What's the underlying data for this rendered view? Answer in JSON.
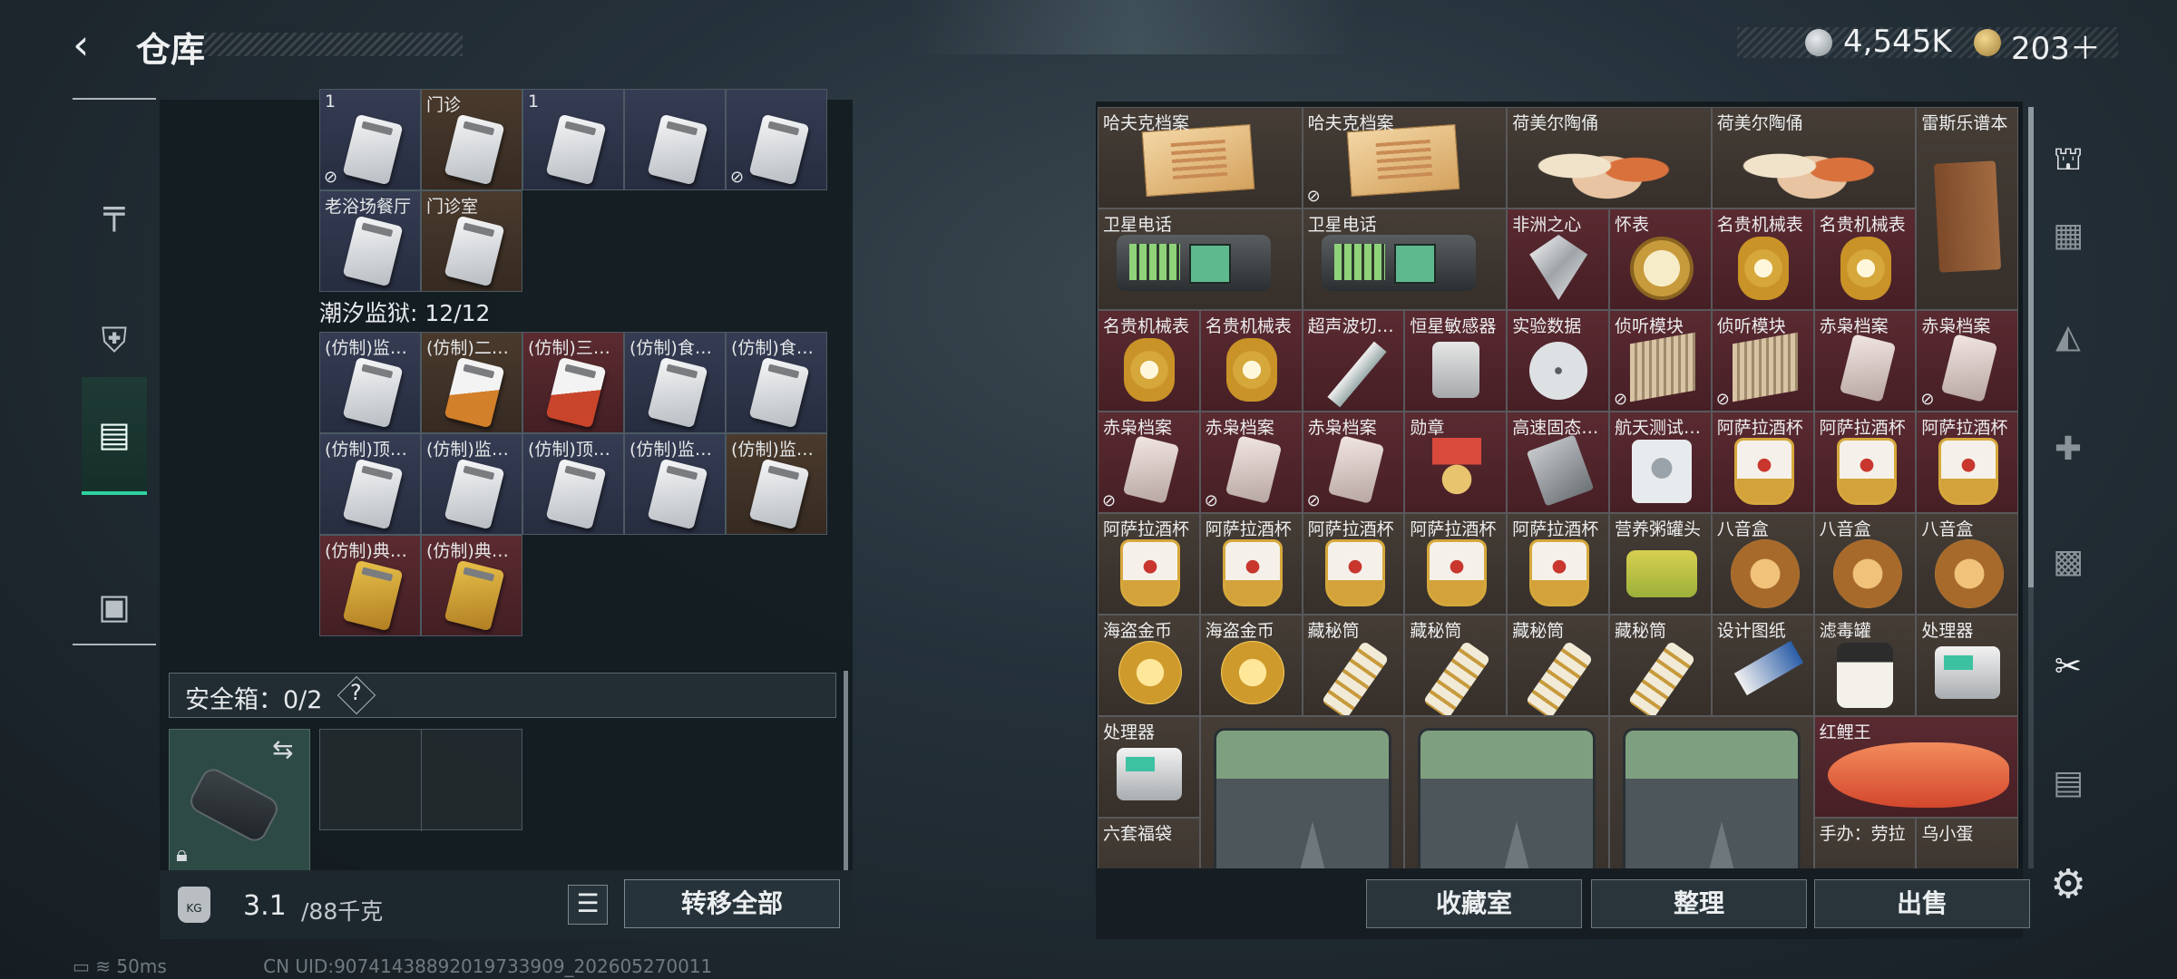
{
  "header": {
    "title": "仓库",
    "currency1": "4,545K",
    "currency2": "203＋",
    "coin1_icon": "silver-coin-icon",
    "coin2_icon": "gold-coin-icon"
  },
  "left_nav": [
    {
      "icon": "gun-icon",
      "glyph": "╤"
    },
    {
      "icon": "armor-icon",
      "glyph": "⛨"
    },
    {
      "icon": "warehouse-icon",
      "glyph": "▤"
    },
    {
      "icon": "toolbox-icon",
      "glyph": "▣"
    }
  ],
  "left_items": {
    "row0": [
      {
        "name": "1 ",
        "color": "blue",
        "lock": true
      },
      {
        "name": "门诊",
        "color": "brown",
        "lock": false
      },
      {
        "name": "1 ",
        "color": "blue",
        "lock": false
      },
      {
        "name": "",
        "color": "blue",
        "lock": false
      },
      {
        "name": "",
        "color": "blue",
        "lock": true
      }
    ],
    "row1": [
      {
        "name": "老浴场餐厅",
        "color": "blue"
      },
      {
        "name": "门诊室",
        "color": "brown"
      }
    ],
    "section_title": "潮汐监狱: 12/12",
    "prison": [
      {
        "name": "(仿制)监…",
        "color": "blue",
        "card": "blue"
      },
      {
        "name": "(仿制)二…",
        "color": "brown",
        "card": "orange"
      },
      {
        "name": "(仿制)三…",
        "color": "red",
        "card": "red"
      },
      {
        "name": "(仿制)食…",
        "color": "blue",
        "card": "blue"
      },
      {
        "name": "(仿制)食…",
        "color": "blue",
        "card": "blue"
      },
      {
        "name": "(仿制)顶…",
        "color": "blue",
        "card": "blue"
      },
      {
        "name": "(仿制)监…",
        "color": "blue",
        "card": "blue"
      },
      {
        "name": "(仿制)顶…",
        "color": "blue",
        "card": "blue"
      },
      {
        "name": "(仿制)监…",
        "color": "blue",
        "card": "blue"
      },
      {
        "name": "(仿制)监…",
        "color": "brown",
        "card": "blue"
      },
      {
        "name": "(仿制)典…",
        "color": "red",
        "card": "gold"
      },
      {
        "name": "(仿制)典…",
        "color": "red",
        "card": "gold"
      }
    ]
  },
  "safe_box": {
    "label": "安全箱：0/2",
    "help": "?"
  },
  "weight": {
    "current": "3.1",
    "max": "/88千克",
    "icon_text": "KG"
  },
  "buttons": {
    "transfer_all": "转移全部",
    "collection": "收藏室",
    "sort": "整理",
    "sell": "出售"
  },
  "status": {
    "ping": "50ms",
    "uid": "CN UID:9074143889201973390​9_202605270011"
  },
  "right_items": [
    {
      "name": "哈夫克档案",
      "c": "b",
      "ic": "doc",
      "w": 2,
      "lock": false
    },
    {
      "name": "哈夫克档案",
      "c": "b",
      "ic": "doc",
      "w": 2,
      "lock": true
    },
    {
      "name": "荷美尔陶俑",
      "c": "b",
      "ic": "figure",
      "w": 2
    },
    {
      "name": "荷美尔陶俑",
      "c": "b",
      "ic": "figure",
      "w": 2
    },
    {
      "name": "雷斯乐谱本",
      "c": "b",
      "ic": "book",
      "w": 1
    },
    {
      "name": "卫星电话",
      "c": "b",
      "ic": "phone",
      "w": 2
    },
    {
      "name": "卫星电话",
      "c": "b",
      "ic": "phone",
      "w": 2
    },
    {
      "name": "非洲之心",
      "c": "r",
      "ic": "diamond"
    },
    {
      "name": "怀表",
      "c": "r",
      "ic": "pocket"
    },
    {
      "name": "名贵机械表",
      "c": "r",
      "ic": "watch"
    },
    {
      "name": "名贵机械表",
      "c": "r",
      "ic": "watch"
    },
    {
      "name": "名贵机械表",
      "c": "r",
      "ic": "watch"
    },
    {
      "name": "名贵机械表",
      "c": "r",
      "ic": "watch"
    },
    {
      "name": "超声波切…",
      "c": "r",
      "ic": "pen"
    },
    {
      "name": "恒星敏感器",
      "c": "r",
      "ic": "sensor"
    },
    {
      "name": "实验数据",
      "c": "r",
      "ic": "disc"
    },
    {
      "name": "侦听模块",
      "c": "r",
      "ic": "module",
      "lock": true
    },
    {
      "name": "侦听模块",
      "c": "r",
      "ic": "module",
      "lock": true
    },
    {
      "name": "赤枭档案",
      "c": "r",
      "ic": "card"
    },
    {
      "name": "赤枭档案",
      "c": "r",
      "ic": "card",
      "lock": true
    },
    {
      "name": "赤枭档案",
      "c": "r",
      "ic": "card",
      "lock": true
    },
    {
      "name": "赤枭档案",
      "c": "r",
      "ic": "card",
      "lock": true
    },
    {
      "name": "赤枭档案",
      "c": "r",
      "ic": "card",
      "lock": true
    },
    {
      "name": "勋章",
      "c": "r",
      "ic": "medal"
    },
    {
      "name": "高速固态…",
      "c": "r",
      "ic": "ssd"
    },
    {
      "name": "航天测试…",
      "c": "r",
      "ic": "hdd"
    },
    {
      "name": "阿萨拉酒杯",
      "c": "r",
      "ic": "cup"
    },
    {
      "name": "阿萨拉酒杯",
      "c": "r",
      "ic": "cup"
    },
    {
      "name": "阿萨拉酒杯",
      "c": "r",
      "ic": "cup"
    },
    {
      "name": "阿萨拉酒杯",
      "c": "b",
      "ic": "cup"
    },
    {
      "name": "阿萨拉酒杯",
      "c": "b",
      "ic": "cup"
    },
    {
      "name": "阿萨拉酒杯",
      "c": "b",
      "ic": "cup"
    },
    {
      "name": "阿萨拉酒杯",
      "c": "b",
      "ic": "cup"
    },
    {
      "name": "阿萨拉酒杯",
      "c": "b",
      "ic": "cup"
    },
    {
      "name": "营养粥罐头",
      "c": "b",
      "ic": "tin"
    },
    {
      "name": "八音盒",
      "c": "b",
      "ic": "music"
    },
    {
      "name": "八音盒",
      "c": "b",
      "ic": "music"
    },
    {
      "name": "八音盒",
      "c": "b",
      "ic": "music"
    },
    {
      "name": "海盗金币",
      "c": "b",
      "ic": "coin"
    },
    {
      "name": "海盗金币",
      "c": "b",
      "ic": "coin"
    },
    {
      "name": "藏秘筒",
      "c": "b",
      "ic": "cyl"
    },
    {
      "name": "藏秘筒",
      "c": "b",
      "ic": "cyl"
    },
    {
      "name": "藏秘筒",
      "c": "b",
      "ic": "cyl"
    },
    {
      "name": "藏秘筒",
      "c": "b",
      "ic": "cyl"
    },
    {
      "name": "设计图纸",
      "c": "b",
      "ic": "blue"
    },
    {
      "name": "滤毒罐",
      "c": "b",
      "ic": "jar"
    },
    {
      "name": "处理器",
      "c": "b",
      "ic": "proc"
    }
  ],
  "right_bottom": {
    "proc": "处理器",
    "fish": "红鲤王",
    "bag": "六套福袋",
    "f1": "手办：劳拉",
    "f2": "乌小蛋"
  },
  "right_nav_icons": [
    "helmet-icon",
    "armor-card-icon",
    "bag-card-icon",
    "medkit-card-icon",
    "ammo-card-icon",
    "gun-card-icon",
    "card-card-icon"
  ],
  "right_nav_glyphs": [
    "⛫",
    "▦",
    "◭",
    "✚",
    "▩",
    "✂",
    "▤"
  ],
  "gear_glyph": "⚙"
}
